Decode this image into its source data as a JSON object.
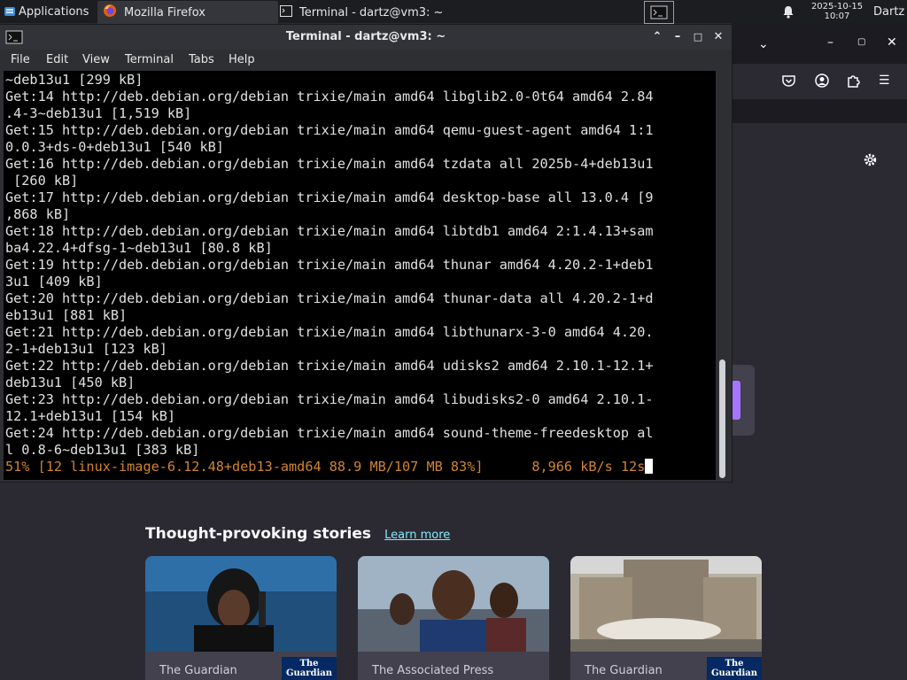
{
  "panel": {
    "applications_label": "Applications",
    "tasks": [
      {
        "label": "Mozilla Firefox"
      },
      {
        "label": "Terminal - dartz@vm3: ~"
      }
    ],
    "clock_date": "2025-10-15",
    "clock_time": "10:07",
    "user": "Dartz"
  },
  "terminal": {
    "title": "Terminal - dartz@vm3: ~",
    "menu": [
      "File",
      "Edit",
      "View",
      "Terminal",
      "Tabs",
      "Help"
    ],
    "lines": [
      "~deb13u1 [299 kB]",
      "Get:14 http://deb.debian.org/debian trixie/main amd64 libglib2.0-0t64 amd64 2.84",
      ".4-3~deb13u1 [1,519 kB]",
      "Get:15 http://deb.debian.org/debian trixie/main amd64 qemu-guest-agent amd64 1:1",
      "0.0.3+ds-0+deb13u1 [540 kB]",
      "Get:16 http://deb.debian.org/debian trixie/main amd64 tzdata all 2025b-4+deb13u1",
      " [260 kB]",
      "Get:17 http://deb.debian.org/debian trixie/main amd64 desktop-base all 13.0.4 [9",
      ",868 kB]",
      "Get:18 http://deb.debian.org/debian trixie/main amd64 libtdb1 amd64 2:1.4.13+sam",
      "ba4.22.4+dfsg-1~deb13u1 [80.8 kB]",
      "Get:19 http://deb.debian.org/debian trixie/main amd64 thunar amd64 4.20.2-1+deb1",
      "3u1 [409 kB]",
      "Get:20 http://deb.debian.org/debian trixie/main amd64 thunar-data all 4.20.2-1+d",
      "eb13u1 [881 kB]",
      "Get:21 http://deb.debian.org/debian trixie/main amd64 libthunarx-3-0 amd64 4.20.",
      "2-1+deb13u1 [123 kB]",
      "Get:22 http://deb.debian.org/debian trixie/main amd64 udisks2 amd64 2.10.1-12.1+",
      "deb13u1 [450 kB]",
      "Get:23 http://deb.debian.org/debian trixie/main amd64 libudisks2-0 amd64 2.10.1-",
      "12.1+deb13u1 [154 kB]",
      "Get:24 http://deb.debian.org/debian trixie/main amd64 sound-theme-freedesktop al",
      "l 0.8-6~deb13u1 [383 kB]"
    ],
    "progress_line": "51% [12 linux-image-6.12.48+deb13-amd64 88.9 MB/107 MB 83%]      8,966 kB/s 12s"
  },
  "browser": {
    "stories_title": "Thought-provoking stories",
    "learn_more": "Learn more",
    "cards": [
      {
        "source": "The Guardian",
        "badge": "The Guardian"
      },
      {
        "source": "The Associated Press",
        "badge": ""
      },
      {
        "source": "The Guardian",
        "badge": "The Guardian"
      }
    ]
  },
  "colors": {
    "progress_text": "#d0842f",
    "link": "#80ebff",
    "guardian_badge": "#052962"
  }
}
